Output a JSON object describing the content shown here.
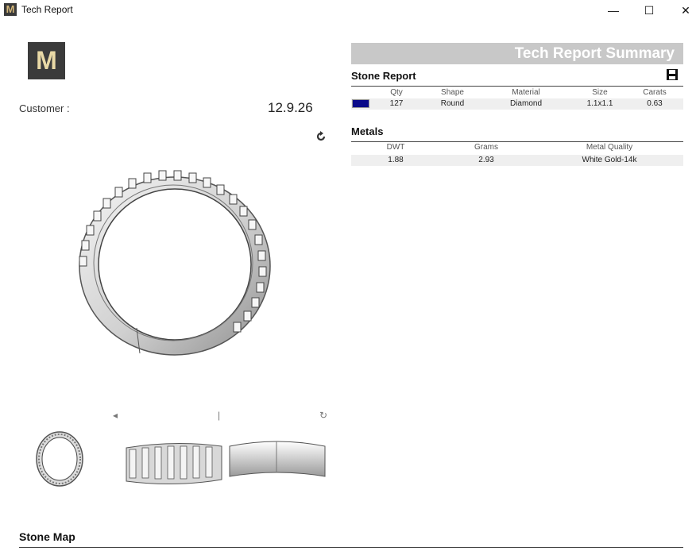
{
  "window": {
    "title": "Tech Report",
    "app_icon_letter": "M",
    "minimize_glyph": "—",
    "maximize_glyph": "☐",
    "close_glyph": "✕"
  },
  "logo": {
    "letter": "M"
  },
  "customer": {
    "label": "Customer :",
    "date": "12.9.26"
  },
  "summary": {
    "title": "Tech Report Summary",
    "stone_report": {
      "title": "Stone Report",
      "headers": {
        "qty": "Qty",
        "shape": "Shape",
        "material": "Material",
        "size": "Size",
        "carats": "Carats"
      },
      "rows": [
        {
          "color": "#0a0a8a",
          "qty": "127",
          "shape": "Round",
          "material": "Diamond",
          "size": "1.1x1.1",
          "carats": "0.63"
        }
      ]
    },
    "metals": {
      "title": "Metals",
      "headers": {
        "dwt": "DWT",
        "grams": "Grams",
        "quality": "Metal Quality"
      },
      "rows": [
        {
          "dwt": "1.88",
          "grams": "2.93",
          "quality": "White Gold-14k"
        }
      ]
    }
  },
  "stone_map": {
    "title": "Stone Map"
  },
  "icons": {
    "rotate": "rotate-icon",
    "save": "save-icon"
  },
  "accent_colors": {
    "summary_bar": "#c8c8c8",
    "stone_swatch": "#0a0a8a"
  }
}
